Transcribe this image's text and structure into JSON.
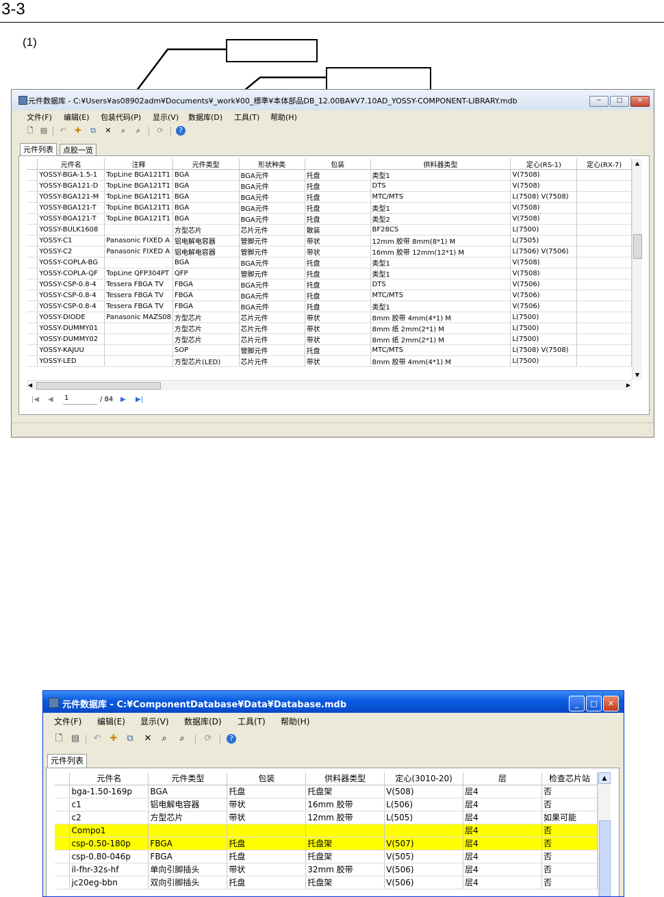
{
  "section_number": "3-3",
  "step_label": "(1)",
  "window1": {
    "title": "元件数据库 - C:¥Users¥a...08902adm¥Documents¥_work¥00_標準¥本体部品DB_12.00BA¥V7.10AD_YOSSY-COMPONENT-LIBRARY.mdb",
    "title_display": "元件数据库 - C:¥Users¥as08902adm¥Documents¥_work¥00_標準¥本体部品DB_12.00BA¥V7.10AD_YOSSY-COMPONENT-LIBRARY.mdb",
    "menu": [
      "文件(F)",
      "编辑(E)",
      "包装代码(P)",
      "显示(V)",
      "数据库(D)",
      "工具(T)",
      "帮助(H)"
    ],
    "tabs": [
      "元件列表",
      "点胶一览"
    ],
    "columns": [
      "元件名",
      "注释",
      "元件类型",
      "形状种类",
      "包装",
      "供料器类型",
      "定心(RS-1)",
      "定心(RX-7)"
    ],
    "rows": [
      [
        "YOSSY-BGA-1.5-1",
        "TopLine BGA121T1",
        "BGA",
        "BGA元件",
        "托盘",
        "类型1",
        "V(7508)",
        ""
      ],
      [
        "YOSSY-BGA121-D",
        "TopLine BGA121T1",
        "BGA",
        "BGA元件",
        "托盘",
        "DTS",
        "V(7508)",
        ""
      ],
      [
        "YOSSY-BGA121-M",
        "TopLine BGA121T1",
        "BGA",
        "BGA元件",
        "托盘",
        "MTC/MTS",
        "L(7508) V(7508)",
        ""
      ],
      [
        "YOSSY-BGA121-T",
        "TopLine BGA121T1",
        "BGA",
        "BGA元件",
        "托盘",
        "类型1",
        "V(7508)",
        ""
      ],
      [
        "YOSSY-BGA121-T",
        "TopLine BGA121T1",
        "BGA",
        "BGA元件",
        "托盘",
        "类型2",
        "V(7508)",
        ""
      ],
      [
        "YOSSY-BULK1608",
        "",
        "方型芯片",
        "芯片元件",
        "散装",
        "BF28CS",
        "L(7500)",
        ""
      ],
      [
        "YOSSY-C1",
        "Panasonic FIXED A",
        "铝电解电容器",
        "管脚元件",
        "带状",
        "12mm 胶带 8mm(8*1) M",
        "L(7505)",
        ""
      ],
      [
        "YOSSY-C2",
        "Panasonic FIXED A",
        "铝电解电容器",
        "管脚元件",
        "带状",
        "16mm 胶带 12mm(12*1) M",
        "L(7506) V(7506)",
        ""
      ],
      [
        "YOSSY-COPLA-BG",
        "",
        "BGA",
        "BGA元件",
        "托盘",
        "类型1",
        "V(7508)",
        ""
      ],
      [
        "YOSSY-COPLA-QF",
        "TopLine QFP304PT",
        "QFP",
        "管脚元件",
        "托盘",
        "类型1",
        "V(7508)",
        ""
      ],
      [
        "YOSSY-CSP-0.8-4",
        "Tessera FBGA TV",
        "FBGA",
        "BGA元件",
        "托盘",
        "DTS",
        "V(7506)",
        ""
      ],
      [
        "YOSSY-CSP-0.8-4",
        "Tessera FBGA TV",
        "FBGA",
        "BGA元件",
        "托盘",
        "MTC/MTS",
        "V(7506)",
        ""
      ],
      [
        "YOSSY-CSP-0.8-4",
        "Tessera FBGA TV",
        "FBGA",
        "BGA元件",
        "托盘",
        "类型1",
        "V(7506)",
        ""
      ],
      [
        "YOSSY-DIODE",
        "Panasonic MAZS08",
        "方型芯片",
        "芯片元件",
        "带状",
        "8mm 胶带 4mm(4*1) M",
        "L(7500)",
        ""
      ],
      [
        "YOSSY-DUMMY01",
        "",
        "方型芯片",
        "芯片元件",
        "带状",
        "8mm 纸 2mm(2*1) M",
        "L(7500)",
        ""
      ],
      [
        "YOSSY-DUMMY02",
        "",
        "方型芯片",
        "芯片元件",
        "带状",
        "8mm 纸 2mm(2*1) M",
        "L(7500)",
        ""
      ],
      [
        "YOSSY-KAJUU",
        "",
        "SOP",
        "管脚元件",
        "托盘",
        "MTC/MTS",
        "L(7508) V(7508)",
        ""
      ],
      [
        "YOSSY-LED",
        "",
        "方型芯片(LED)",
        "芯片元件",
        "带状",
        "8mm 胶带 4mm(4*1) M",
        "L(7500)",
        ""
      ]
    ],
    "nav": {
      "first": "|◀",
      "prev": "◀",
      "page": "1",
      "total": "/ 84",
      "next": "▶",
      "last": "▶|"
    }
  },
  "window2": {
    "title": "元件数据库 - C:¥ComponentDatabase¥Data¥Database.mdb",
    "menu": [
      "文件(F)",
      "编辑(E)",
      "显示(V)",
      "数据库(D)",
      "工具(T)",
      "帮助(H)"
    ],
    "tabs": [
      "元件列表"
    ],
    "columns": [
      "元件名",
      "元件类型",
      "包装",
      "供料器类型",
      "定心(3010-20)",
      "层",
      "检查芯片站"
    ],
    "rows": [
      [
        "bga-1.50-169p",
        "BGA",
        "托盘",
        "托盘架",
        "V(508)",
        "层4",
        "否"
      ],
      [
        "c1",
        "铝电解电容器",
        "带状",
        "16mm 胶带",
        "L(506)",
        "层4",
        "否"
      ],
      [
        "c2",
        "方型芯片",
        "带状",
        "12mm 胶带",
        "L(505)",
        "层4",
        "如果可能"
      ],
      [
        "Compo1",
        "",
        "",
        "",
        "",
        "层4",
        "否"
      ],
      [
        "csp-0.50-180p",
        "FBGA",
        "托盘",
        "托盘架",
        "V(507)",
        "层4",
        "否"
      ],
      [
        "csp-0.80-046p",
        "FBGA",
        "托盘",
        "托盘架",
        "V(505)",
        "层4",
        "否"
      ],
      [
        "il-fhr-32s-hf",
        "单向引脚插头",
        "带状",
        "32mm 胶带",
        "V(506)",
        "层4",
        "否"
      ],
      [
        "jc20eg-bbn",
        "双向引脚插头",
        "托盘",
        "托盘架",
        "V(506)",
        "层4",
        "否"
      ]
    ],
    "highlight_rows": [
      3,
      4
    ],
    "highlight_color": "#ffff00"
  }
}
